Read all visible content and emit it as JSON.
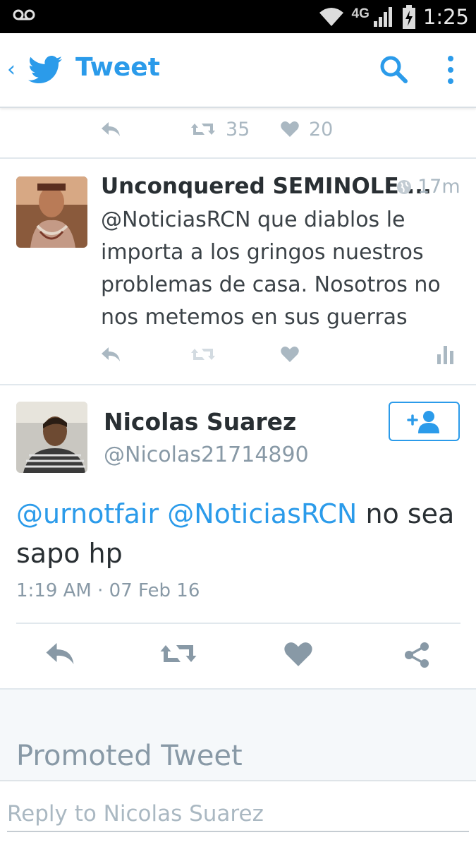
{
  "statusbar": {
    "time": "1:25",
    "network": "4G",
    "icons": [
      "voicemail-icon",
      "wifi-icon",
      "signal-icon",
      "battery-charging-icon"
    ]
  },
  "appbar": {
    "title": "Tweet",
    "back_icon": "chevron-left-icon",
    "logo_icon": "twitter-bird-icon",
    "search_icon": "search-icon",
    "menu_icon": "overflow-menu-icon"
  },
  "top_actions": {
    "retweets": "35",
    "likes": "20"
  },
  "reply_tweet": {
    "name": "Unconquered SEMINOLE ...",
    "time": "17m",
    "text": "@NoticiasRCN que diablos le importa a los gringos nuestros problemas de casa. Nosotros no nos metemos en sus guerras"
  },
  "main_tweet": {
    "name": "Nicolas Suarez",
    "handle": "@Nicolas21714890",
    "mention1": "@urnotfair",
    "mention2": "@NoticiasRCN",
    "text_rest": " no sea sapo hp",
    "meta": "1:19 AM · 07 Feb 16"
  },
  "promoted": {
    "label": "Promoted Tweet"
  },
  "reply_box": {
    "placeholder": "Reply to Nicolas Suarez"
  },
  "colors": {
    "accent": "#2b9bea",
    "muted": "#aab8c2",
    "text": "#292f33",
    "secondary": "#8899a6"
  }
}
